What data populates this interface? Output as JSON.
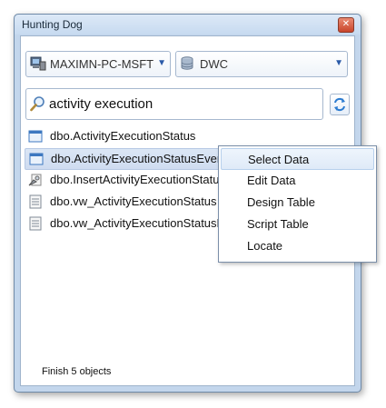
{
  "window": {
    "title": "Hunting Dog",
    "close_icon": "close-icon"
  },
  "server_combo": {
    "value": "MAXIMN-PC-MSFT",
    "icon": "computer-icon"
  },
  "database_combo": {
    "value": "DWC",
    "icon": "database-icon"
  },
  "search": {
    "value": "activity execution",
    "icon": "search-icon"
  },
  "refresh": {
    "icon": "refresh-icon"
  },
  "results": [
    {
      "label": "dbo.ActivityExecutionStatus",
      "icon": "table-icon"
    },
    {
      "label": "dbo.ActivityExecutionStatusEvent",
      "icon": "table-icon"
    },
    {
      "label": "dbo.InsertActivityExecutionStatusEvent",
      "icon": "stored-procedure-icon"
    },
    {
      "label": "dbo.vw_ActivityExecutionStatus",
      "icon": "view-icon"
    },
    {
      "label": "dbo.vw_ActivityExecutionStatusEvent",
      "icon": "view-icon"
    }
  ],
  "context_menu": {
    "items": [
      "Select Data",
      "Edit Data",
      "Design Table",
      "Script Table",
      "Locate"
    ]
  },
  "status": {
    "text": "Finish 5 objects"
  }
}
